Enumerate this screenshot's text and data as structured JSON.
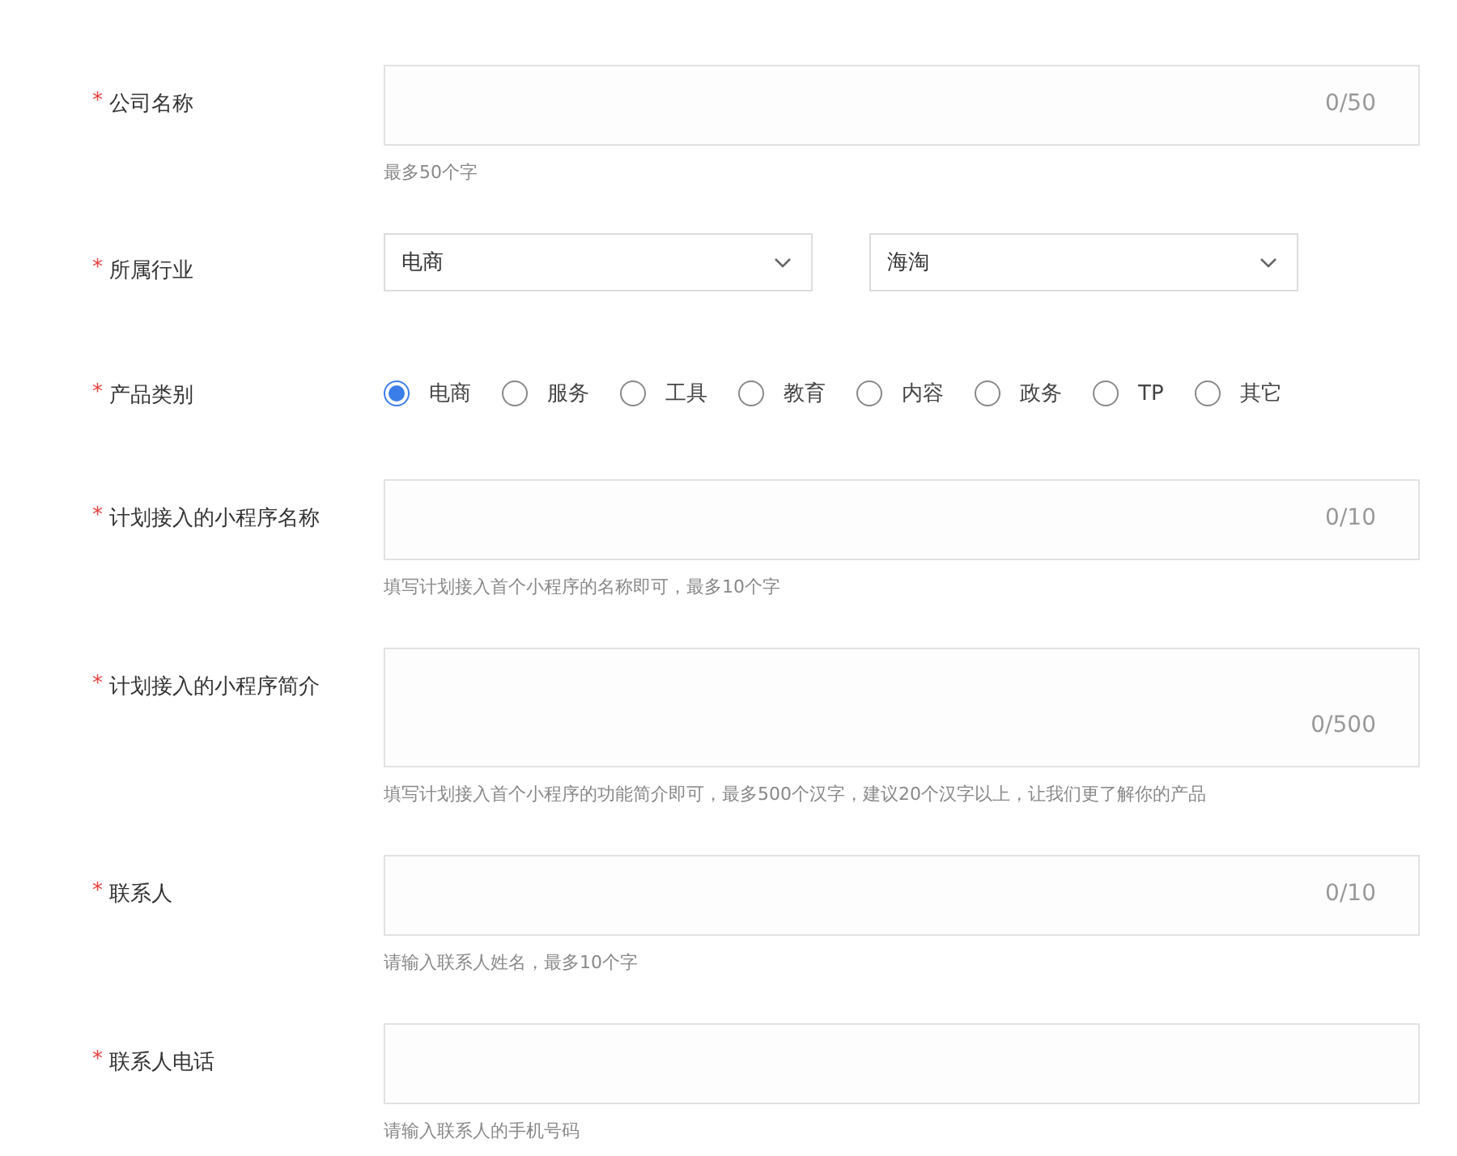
{
  "rows": [
    {
      "kind": "input",
      "mark": "*",
      "label": "公司名称",
      "counter": "0/50",
      "hint": "最多50个字"
    },
    {
      "kind": "selects",
      "mark": "*",
      "label": "所属行业",
      "selects": [
        {
          "value": "电商"
        },
        {
          "value": "海淘"
        }
      ]
    },
    {
      "kind": "radios",
      "mark": "*",
      "label": "产品类别",
      "options": [
        {
          "label": "电商",
          "selected": true
        },
        {
          "label": "服务",
          "selected": false
        },
        {
          "label": "工具",
          "selected": false
        },
        {
          "label": "教育",
          "selected": false
        },
        {
          "label": "内容",
          "selected": false
        },
        {
          "label": "政务",
          "selected": false
        },
        {
          "label": "TP",
          "selected": false
        },
        {
          "label": "其它",
          "selected": false
        }
      ]
    },
    {
      "kind": "input",
      "mark": "*",
      "label": "计划接入的小程序名称",
      "counter": "0/10",
      "hint": "填写计划接入首个小程序的名称即可，最多10个字"
    },
    {
      "kind": "textarea",
      "mark": "*",
      "label": "计划接入的小程序简介",
      "counter": "0/500",
      "hint": "填写计划接入首个小程序的功能简介即可，最多500个汉字，建议20个汉字以上，让我们更了解你的产品"
    },
    {
      "kind": "input",
      "mark": "*",
      "label": "联系人",
      "counter": "0/10",
      "hint": "请输入联系人姓名，最多10个字"
    },
    {
      "kind": "input",
      "mark": "*",
      "label": "联系人电话",
      "hint": "请输入联系人的手机号码"
    }
  ]
}
